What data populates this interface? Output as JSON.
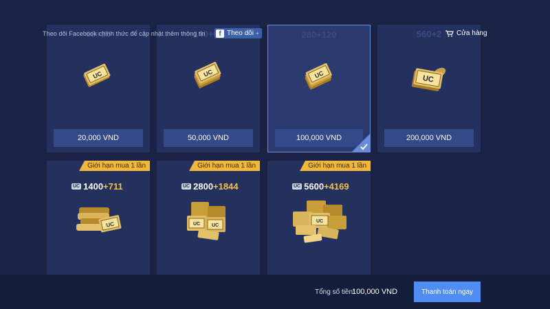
{
  "topbar": {
    "notice": "Theo dõi Facebook chính thức để cập nhật thêm thông tin",
    "follow_label": "Theo dõi",
    "follow_plus": "+",
    "store_label": "Cửa hàng"
  },
  "row1": [
    {
      "uc_base": "60",
      "uc_bonus": "+25",
      "price": "20,000 VND",
      "selected": false
    },
    {
      "uc_base": "140",
      "uc_bonus": "+60",
      "price": "50,000 VND",
      "selected": false
    },
    {
      "uc_base": "280",
      "uc_bonus": "+120",
      "price": "100,000 VND",
      "selected": true
    },
    {
      "uc_base": "560",
      "uc_bonus": "+2",
      "price": "200,000 VND",
      "selected": false
    }
  ],
  "row2": [
    {
      "ribbon": "Giới hạn mua 1 lần",
      "uc_base": "1400",
      "uc_bonus": "+711"
    },
    {
      "ribbon": "Giới hạn mua 1 lần",
      "uc_base": "2800",
      "uc_bonus": "+1844"
    },
    {
      "ribbon": "Giới hạn mua 1 lần",
      "uc_base": "5600",
      "uc_bonus": "+4169"
    }
  ],
  "uc_badge": "UC",
  "footer": {
    "total_label": "Tổng số tiền:",
    "total_value": "100,000 VND",
    "pay_button": "Thanh toán ngay"
  },
  "colors": {
    "background": "#1a2346",
    "card": "#24315f",
    "price_bar": "#344988",
    "accent_gold": "#f3c14b",
    "pay_button": "#4f8df5"
  }
}
